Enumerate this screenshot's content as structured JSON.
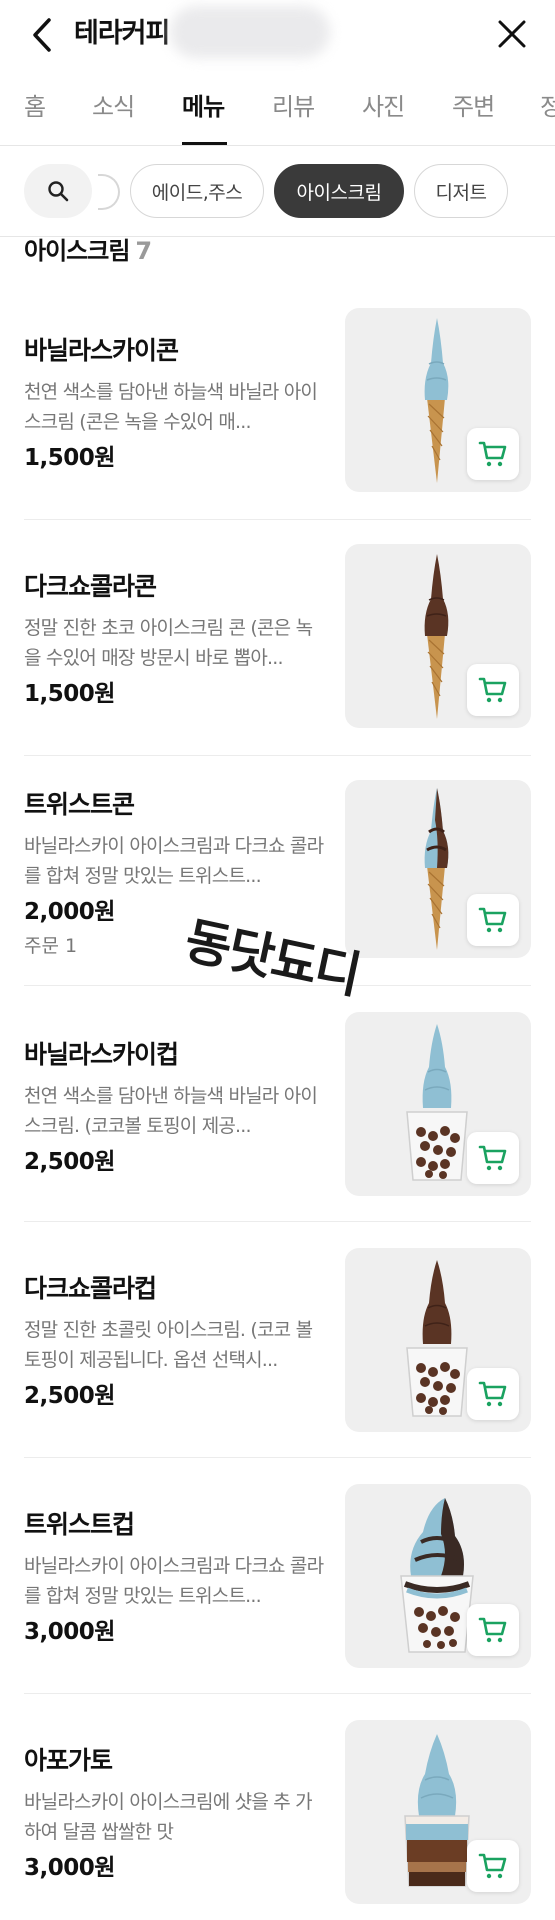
{
  "header": {
    "back_icon": "chevron-left-icon",
    "title": "테라커피",
    "close_icon": "close-icon"
  },
  "tabs": [
    {
      "label": "홈"
    },
    {
      "label": "소식"
    },
    {
      "label": "메뉴",
      "active": true
    },
    {
      "label": "리뷰"
    },
    {
      "label": "사진"
    },
    {
      "label": "주변"
    },
    {
      "label": "정"
    }
  ],
  "chips": {
    "search_icon": "search-icon",
    "items": [
      {
        "label": "에이드,주스"
      },
      {
        "label": "아이스크림",
        "active": true
      },
      {
        "label": "디저트"
      }
    ]
  },
  "section": {
    "title": "아이스크림",
    "count": "7"
  },
  "menu_items": [
    {
      "name": "바닐라스카이콘",
      "desc": "천연 색소를 담아낸 하늘색 바닐라 아이스크림 (콘은 녹을 수있어 매...",
      "price": "1,500원",
      "image": "sky-cone"
    },
    {
      "name": "다크쇼콜라콘",
      "desc": "정말 진한 초코 아이스크림 콘 (콘은 녹을 수있어 매장 방문시 바로 뽑아...",
      "price": "1,500원",
      "image": "choco-cone"
    },
    {
      "name": "트위스트콘",
      "desc": "바닐라스카이 아이스크림과 다크쇼 콜라를 합쳐 정말 맛있는 트위스트...",
      "price": "2,000원",
      "order": "주문 1",
      "image": "twist-cone"
    },
    {
      "name": "바닐라스카이컵",
      "desc": "천연 색소를 담아낸 하늘색 바닐라 아이스크림. (코코볼 토핑이 제공...",
      "price": "2,500원",
      "image": "sky-cup"
    },
    {
      "name": "다크쇼콜라컵",
      "desc": "정말 진한 초콜릿 아이스크림. (코코 볼 토핑이 제공됩니다. 옵션 선택시...",
      "price": "2,500원",
      "image": "choco-cup"
    },
    {
      "name": "트위스트컵",
      "desc": "바닐라스카이 아이스크림과 다크쇼 콜라를 합쳐 정말 맛있는 트위스트...",
      "price": "3,000원",
      "image": "twist-cup"
    },
    {
      "name": "아포가토",
      "desc": "바닐라스카이 아이스크림에 샷을 추 가하여 달콤 쌉쌀한 맛",
      "price": "3,000원",
      "image": "affogato"
    }
  ],
  "watermark": "동닷됴디",
  "colors": {
    "accent_green": "#1aa260",
    "sky_blue": "#8fbfd3",
    "chocolate": "#5a3424",
    "cone": "#c8944e"
  }
}
